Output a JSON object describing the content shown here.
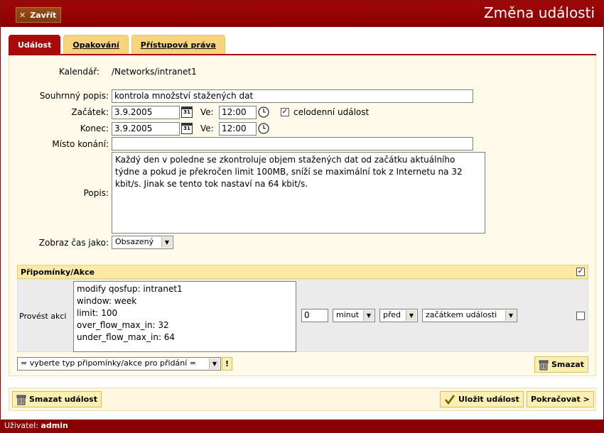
{
  "header": {
    "close_label": "Zavřít",
    "title": "Změna události"
  },
  "tabs": [
    {
      "label": "Událost",
      "active": true
    },
    {
      "label": "Opakování",
      "active": false
    },
    {
      "label": "Přístupová práva",
      "active": false
    }
  ],
  "form": {
    "calendar_label": "Kalendář:",
    "calendar_value": "/Networks/intranet1",
    "summary_label": "Souhrnný popis:",
    "summary_value": "kontrola množství stažených dat",
    "start_label": "Začátek:",
    "start_date": "3.9.2005",
    "time_label": "Ve:",
    "start_time": "12:00",
    "allday_label": "celodenní událost",
    "allday_checked": true,
    "end_label": "Konec:",
    "end_date": "3.9.2005",
    "end_time": "12:00",
    "location_label": "Místo konání:",
    "location_value": "",
    "description_label": "Popis:",
    "description_value": "Každý den v poledne se zkontroluje objem stažených dat od začátku aktuálního týdne a pokud  je překročen limit 100MB, sníží se maximální tok z Internetu na 32 kbit/s. Jinak se tento tok nastaví na 64 kbit/s.",
    "show_time_label": "Zobraz čas jako:",
    "show_time_value": "Obsazený",
    "calendar_icon_text": "31"
  },
  "reminders": {
    "header": "Připomínky/Akce",
    "header_checked": true,
    "row_label": "Provést akci",
    "action_lines": [
      "modify qosfup: intranet1",
      "window: week",
      "limit: 100",
      "over_flow_max_in: 32",
      "under_flow_max_in: 64"
    ],
    "amount": "0",
    "unit": "minut",
    "relation": "před",
    "anchor": "začátkem události",
    "row_checked": false,
    "add_type_placeholder": "= vyberte typ připomínky/akce pro přidání =",
    "add_button": "!",
    "delete_label": "Smazat"
  },
  "footer": {
    "delete_event": "Smazat událost",
    "save_event": "Uložit událost",
    "continue": "Pokračovat >"
  },
  "status": {
    "user_label": "Uživatel:",
    "user_name": "admin"
  }
}
